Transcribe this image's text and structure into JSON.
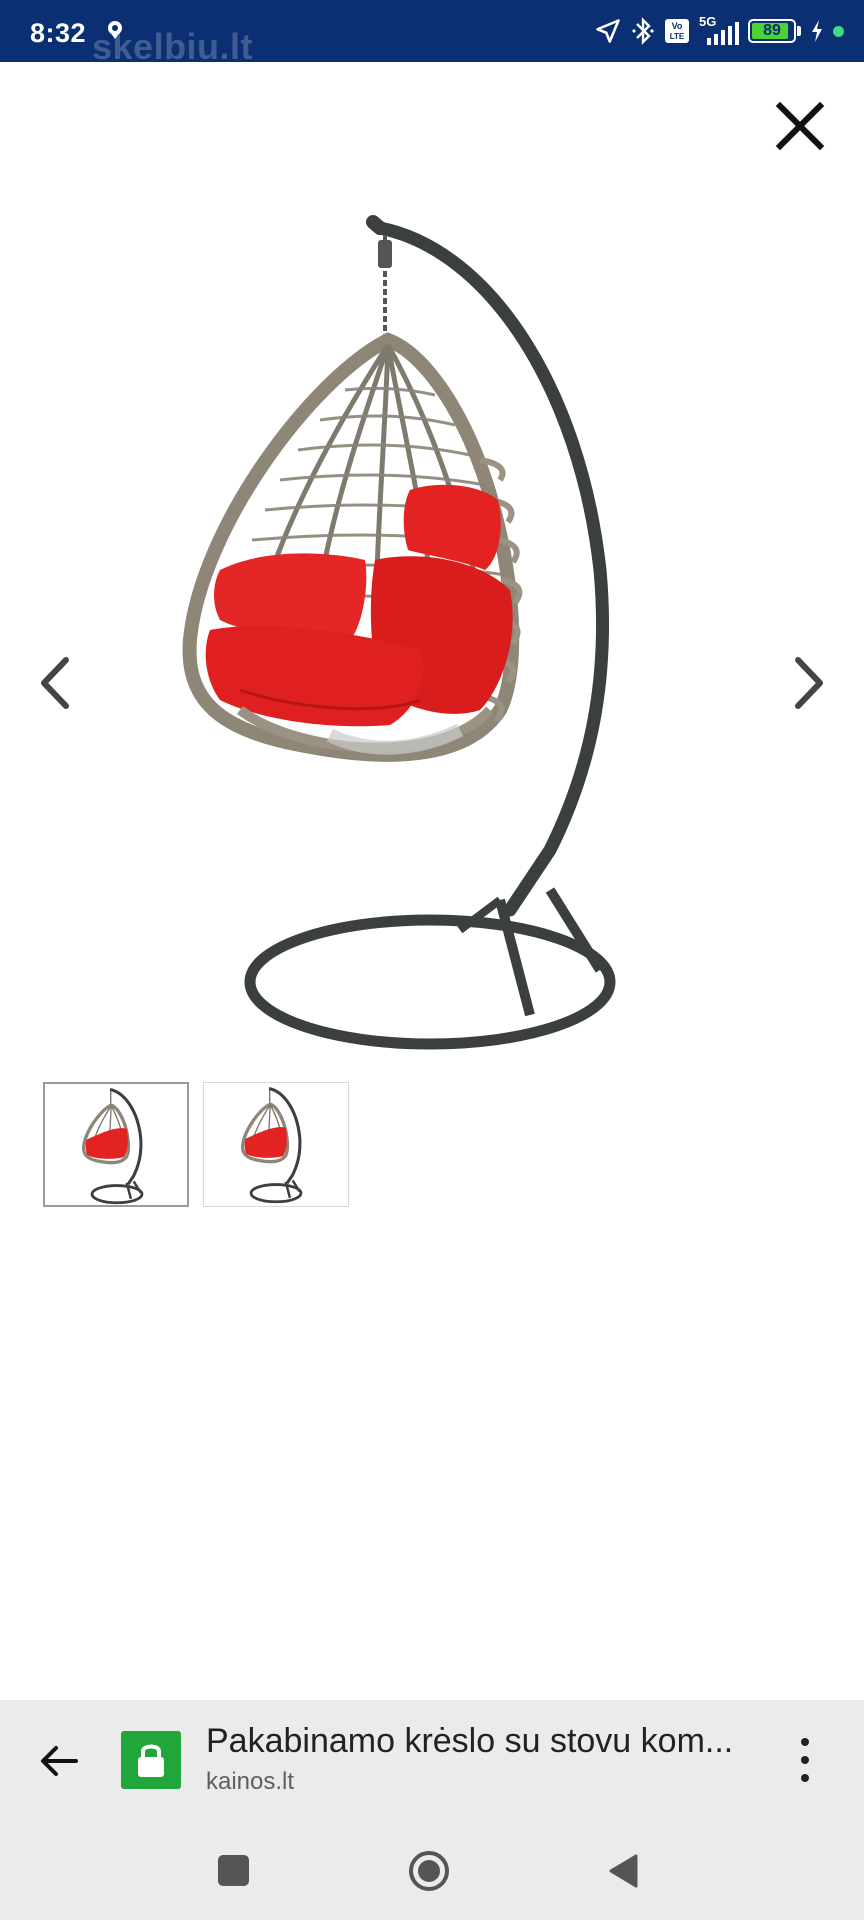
{
  "status_bar": {
    "time": "8:32",
    "watermark": "skelbiu.lt",
    "battery_level": "89",
    "network": "5G",
    "volte_badge": "Vo LTE",
    "icons": [
      "location-icon",
      "navigation-icon",
      "bluetooth-icon",
      "volte-icon",
      "signal-icon",
      "battery-icon",
      "charging-icon",
      "green-dot-icon"
    ]
  },
  "viewer": {
    "close_icon": "close-icon",
    "prev_icon": "chevron-left-icon",
    "next_icon": "chevron-right-icon",
    "main_image": "hanging-egg-chair-red-cushions",
    "thumbnails": [
      {
        "image": "hanging-egg-chair-red-cushions",
        "selected": true
      },
      {
        "image": "hanging-egg-chair-red-cushions",
        "selected": false
      }
    ]
  },
  "address_bar": {
    "back_icon": "back-arrow-icon",
    "lock_icon": "lock-icon",
    "title": "Pakabinamo krėslo su stovu kom...",
    "domain": "kainos.lt",
    "menu_icon": "more-vert-icon",
    "lock_color": "#21a63b"
  },
  "nav_bar": {
    "recent_icon": "square-icon",
    "home_icon": "circle-icon",
    "back_icon": "triangle-back-icon"
  },
  "colors": {
    "status_bar_bg": "#0b2f73",
    "cushion_red": "#e32222",
    "frame_gray": "#3c3f3f"
  }
}
